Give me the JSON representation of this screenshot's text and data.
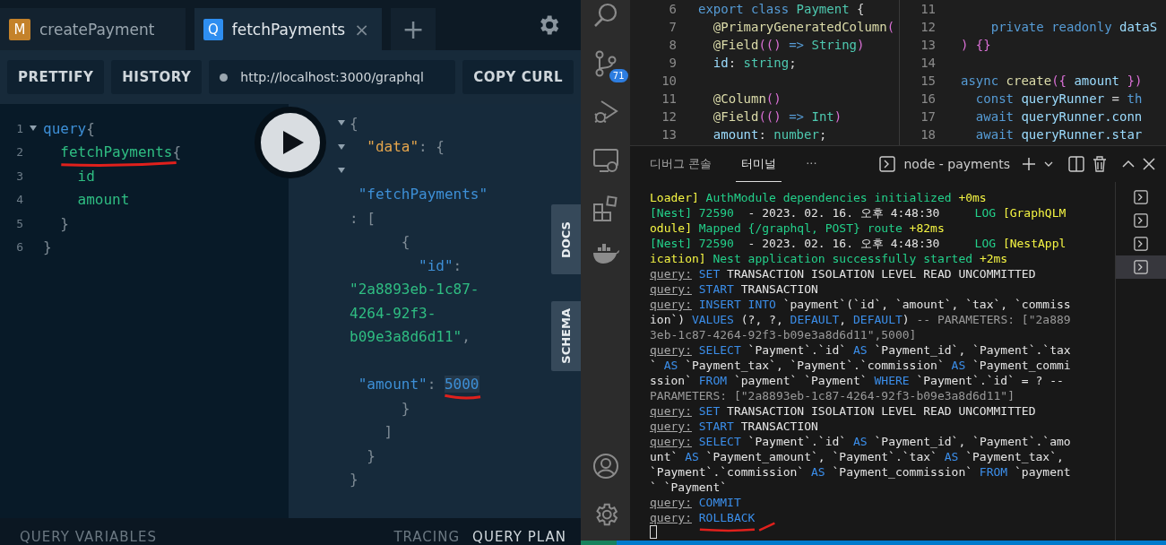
{
  "playground": {
    "tabs": [
      {
        "badge": "M",
        "kind": "mutation",
        "label": "createPayment",
        "selected": false
      },
      {
        "badge": "Q",
        "kind": "query",
        "label": "fetchPayments",
        "selected": true,
        "close": "×"
      }
    ],
    "new_tab": "+",
    "toolbar": {
      "buttons": [
        "PRETTIFY",
        "HISTORY"
      ],
      "url": "http://localhost:3000/graphql",
      "copy_button": "COPY CURL"
    },
    "query_lines": [
      {
        "number": "1",
        "fold": true,
        "tokens": [
          {
            "kind": "keyword",
            "text": "query"
          },
          {
            "kind": "punct",
            "text": "{"
          }
        ]
      },
      {
        "number": "2",
        "fold": false,
        "tokens": [
          {
            "kind": "field",
            "text": "  fetchPayments",
            "annotated": true
          },
          {
            "kind": "punct",
            "text": "{"
          }
        ]
      },
      {
        "number": "3",
        "fold": false,
        "tokens": [
          {
            "kind": "field",
            "text": "    id"
          }
        ]
      },
      {
        "number": "4",
        "fold": false,
        "tokens": [
          {
            "kind": "field",
            "text": "    amount"
          }
        ]
      },
      {
        "number": "5",
        "fold": false,
        "tokens": [
          {
            "kind": "punct",
            "text": "  }"
          }
        ]
      },
      {
        "number": "6",
        "fold": false,
        "tokens": [
          {
            "kind": "punct",
            "text": "}"
          }
        ]
      }
    ],
    "response_lines": [
      {
        "fold": true,
        "tokens": [
          {
            "kind": "punct",
            "text": "{"
          }
        ]
      },
      {
        "fold": true,
        "tokens": [
          {
            "kind": "key",
            "text": "  \"data\""
          },
          {
            "kind": "punct",
            "text": ": {"
          }
        ]
      },
      {
        "fold": true
      },
      {
        "fold": false,
        "tokens": [
          {
            "kind": "name",
            "text": " \"fetchPayments\""
          }
        ]
      },
      {
        "fold": false,
        "tokens": [
          {
            "kind": "punct",
            "text": ": ["
          }
        ]
      },
      {
        "fold": false,
        "tokens": [
          {
            "kind": "punct",
            "text": "      {"
          }
        ]
      },
      {
        "fold": false,
        "tokens": [
          {
            "kind": "name",
            "text": "        \"id\""
          },
          {
            "kind": "punct",
            "text": ":"
          }
        ]
      },
      {
        "fold": false,
        "tokens": [
          {
            "kind": "string",
            "text": "\"2a8893eb-1c87-"
          }
        ]
      },
      {
        "fold": false,
        "tokens": [
          {
            "kind": "string",
            "text": "4264-92f3-"
          }
        ]
      },
      {
        "fold": false,
        "tokens": [
          {
            "kind": "string",
            "text": "b09e3a8d6d11\""
          },
          {
            "kind": "punct",
            "text": ","
          }
        ]
      },
      {
        "fold": false
      },
      {
        "fold": false,
        "tokens": [
          {
            "kind": "name",
            "text": " \"amount\""
          },
          {
            "kind": "punct",
            "text": ": "
          },
          {
            "kind": "number",
            "text": "5000",
            "annotated": true
          }
        ]
      },
      {
        "fold": false,
        "tokens": [
          {
            "kind": "punct",
            "text": "      }"
          }
        ]
      },
      {
        "fold": false,
        "tokens": [
          {
            "kind": "punct",
            "text": "    ]"
          }
        ]
      },
      {
        "fold": false,
        "tokens": [
          {
            "kind": "punct",
            "text": "  }"
          }
        ]
      },
      {
        "fold": false,
        "tokens": [
          {
            "kind": "punct",
            "text": "}"
          }
        ]
      }
    ],
    "side_tabs": [
      "DOCS",
      "SCHEMA"
    ],
    "footer": {
      "left": "QUERY VARIABLES",
      "right": [
        {
          "label": "TRACING",
          "selected": false
        },
        {
          "label": "QUERY PLAN",
          "selected": true
        }
      ]
    }
  },
  "vscode": {
    "source_control_badge": "71",
    "editor_panes": [
      {
        "lines": [
          {
            "number": "6",
            "tokens": [
              {
                "kind": "keyword",
                "text": "export class "
              },
              {
                "kind": "type",
                "text": "Payment"
              },
              {
                "kind": "punct",
                "text": " {"
              }
            ]
          },
          {
            "number": "7",
            "tokens": [
              {
                "kind": "decorator",
                "text": "  @PrimaryGeneratedColumn"
              },
              {
                "kind": "bracket",
                "text": "("
              }
            ]
          },
          {
            "number": "8",
            "tokens": [
              {
                "kind": "decorator",
                "text": "  @Field"
              },
              {
                "kind": "bracket",
                "text": "(()"
              },
              {
                "kind": "keyword",
                "text": " => "
              },
              {
                "kind": "type",
                "text": "String"
              },
              {
                "kind": "bracket",
                "text": ")"
              }
            ]
          },
          {
            "number": "9",
            "tokens": [
              {
                "kind": "variable",
                "text": "  id"
              },
              {
                "kind": "punct",
                "text": ": "
              },
              {
                "kind": "type",
                "text": "string"
              },
              {
                "kind": "punct",
                "text": ";"
              }
            ]
          },
          {
            "number": "10"
          },
          {
            "number": "11",
            "tokens": [
              {
                "kind": "decorator",
                "text": "  @Column"
              },
              {
                "kind": "bracket",
                "text": "()"
              }
            ]
          },
          {
            "number": "12",
            "tokens": [
              {
                "kind": "decorator",
                "text": "  @Field"
              },
              {
                "kind": "bracket",
                "text": "(()"
              },
              {
                "kind": "keyword",
                "text": " => "
              },
              {
                "kind": "type",
                "text": "Int"
              },
              {
                "kind": "bracket",
                "text": ")"
              }
            ]
          },
          {
            "number": "13",
            "tokens": [
              {
                "kind": "variable",
                "text": "  amount"
              },
              {
                "kind": "punct",
                "text": ": "
              },
              {
                "kind": "type",
                "text": "number"
              },
              {
                "kind": "punct",
                "text": ";"
              }
            ]
          }
        ]
      },
      {
        "lines": [
          {
            "number": "11"
          },
          {
            "number": "12",
            "tokens": [
              {
                "kind": "keyword",
                "text": "    private readonly "
              },
              {
                "kind": "variable",
                "text": "dataS"
              }
            ]
          },
          {
            "number": "13",
            "tokens": [
              {
                "kind": "bracket",
                "text": ") {}"
              }
            ]
          },
          {
            "number": "14"
          },
          {
            "number": "15",
            "tokens": [
              {
                "kind": "keyword",
                "text": "async "
              },
              {
                "kind": "decorator",
                "text": "create"
              },
              {
                "kind": "bracket",
                "text": "({"
              },
              {
                "kind": "variable",
                "text": " amount "
              },
              {
                "kind": "bracket",
                "text": "})"
              }
            ]
          },
          {
            "number": "16",
            "tokens": [
              {
                "kind": "keyword",
                "text": "  const "
              },
              {
                "kind": "variable",
                "text": "queryRunner"
              },
              {
                "kind": "punct",
                "text": " = "
              },
              {
                "kind": "keyword",
                "text": "th"
              }
            ]
          },
          {
            "number": "17",
            "tokens": [
              {
                "kind": "keyword",
                "text": "  await "
              },
              {
                "kind": "variable",
                "text": "queryRunner.conn"
              }
            ]
          },
          {
            "number": "18",
            "tokens": [
              {
                "kind": "keyword",
                "text": "  await "
              },
              {
                "kind": "variable",
                "text": "queryRunner.star"
              }
            ]
          }
        ]
      }
    ],
    "panel": {
      "tabs": [
        {
          "label": "디버그 콘솔",
          "selected": false
        },
        {
          "label": "터미널",
          "selected": true
        }
      ],
      "more": "···",
      "terminal_name": "node - payments"
    },
    "terminal_lines": [
      [
        {
          "kind": "module",
          "text": "Loader]"
        },
        {
          "kind": "message",
          "text": " AuthModule dependencies initialized "
        },
        {
          "kind": "module",
          "text": "+0ms"
        }
      ],
      [
        {
          "kind": "message",
          "text": "[Nest] 72590"
        },
        {
          "kind": "plain",
          "text": "  - 2023. 02. 16. 오후 4:48:30     "
        },
        {
          "kind": "message",
          "text": "LOG "
        },
        {
          "kind": "module",
          "text": "[GraphQLM"
        }
      ],
      [
        {
          "kind": "module",
          "text": "odule]"
        },
        {
          "kind": "message",
          "text": " Mapped {/graphql, POST} route "
        },
        {
          "kind": "module",
          "text": "+82ms"
        }
      ],
      [
        {
          "kind": "message",
          "text": "[Nest] 72590"
        },
        {
          "kind": "plain",
          "text": "  - 2023. 02. 16. 오후 4:48:30     "
        },
        {
          "kind": "message",
          "text": "LOG "
        },
        {
          "kind": "module",
          "text": "[NestAppl"
        }
      ],
      [
        {
          "kind": "module",
          "text": "ication]"
        },
        {
          "kind": "message",
          "text": " Nest application successfully started "
        },
        {
          "kind": "module",
          "text": "+2ms"
        }
      ],
      [
        {
          "kind": "label",
          "text": "query:"
        },
        {
          "kind": "keyword",
          "text": " SET"
        },
        {
          "kind": "plain",
          "text": " TRANSACTION ISOLATION LEVEL READ UNCOMMITTED"
        }
      ],
      [
        {
          "kind": "label",
          "text": "query:"
        },
        {
          "kind": "keyword",
          "text": " START"
        },
        {
          "kind": "plain",
          "text": " TRANSACTION"
        }
      ],
      [
        {
          "kind": "label",
          "text": "query:"
        },
        {
          "kind": "keyword",
          "text": " INSERT INTO"
        },
        {
          "kind": "plain",
          "text": " `payment`(`id`, `amount`, `tax`, `commiss"
        }
      ],
      [
        {
          "kind": "plain",
          "text": "ion`) "
        },
        {
          "kind": "keyword",
          "text": "VALUES"
        },
        {
          "kind": "plain",
          "text": " (?, ?, "
        },
        {
          "kind": "keyword",
          "text": "DEFAULT"
        },
        {
          "kind": "plain",
          "text": ", "
        },
        {
          "kind": "keyword",
          "text": "DEFAULT"
        },
        {
          "kind": "plain",
          "text": ") "
        },
        {
          "kind": "comment",
          "text": "-- PARAMETERS: [\"2a889"
        }
      ],
      [
        {
          "kind": "comment",
          "text": "3eb-1c87-4264-92f3-b09e3a8d6d11\",5000]"
        }
      ],
      [
        {
          "kind": "label",
          "text": "query:"
        },
        {
          "kind": "keyword",
          "text": " SELECT"
        },
        {
          "kind": "plain",
          "text": " `Payment`.`id` "
        },
        {
          "kind": "keyword",
          "text": "AS"
        },
        {
          "kind": "plain",
          "text": " `Payment_id`, `Payment`.`tax"
        }
      ],
      [
        {
          "kind": "plain",
          "text": "` "
        },
        {
          "kind": "keyword",
          "text": "AS"
        },
        {
          "kind": "plain",
          "text": " `Payment_tax`, `Payment`.`commission` "
        },
        {
          "kind": "keyword",
          "text": "AS"
        },
        {
          "kind": "plain",
          "text": " `Payment_commi"
        }
      ],
      [
        {
          "kind": "plain",
          "text": "ssion` "
        },
        {
          "kind": "keyword",
          "text": "FROM"
        },
        {
          "kind": "plain",
          "text": " `payment` `Payment` "
        },
        {
          "kind": "keyword",
          "text": "WHERE"
        },
        {
          "kind": "plain",
          "text": " `Payment`.`id` = ? --"
        }
      ],
      [
        {
          "kind": "comment",
          "text": "PARAMETERS: [\"2a8893eb-1c87-4264-92f3-b09e3a8d6d11\"]"
        }
      ],
      [
        {
          "kind": "label",
          "text": "query:"
        },
        {
          "kind": "keyword",
          "text": " SET"
        },
        {
          "kind": "plain",
          "text": " TRANSACTION ISOLATION LEVEL READ UNCOMMITTED"
        }
      ],
      [
        {
          "kind": "label",
          "text": "query:"
        },
        {
          "kind": "keyword",
          "text": " START"
        },
        {
          "kind": "plain",
          "text": " TRANSACTION"
        }
      ],
      [
        {
          "kind": "label",
          "text": "query:"
        },
        {
          "kind": "keyword",
          "text": " SELECT"
        },
        {
          "kind": "plain",
          "text": " `Payment`.`id` "
        },
        {
          "kind": "keyword",
          "text": "AS"
        },
        {
          "kind": "plain",
          "text": " `Payment_id`, `Payment`.`amo"
        }
      ],
      [
        {
          "kind": "plain",
          "text": "unt` "
        },
        {
          "kind": "keyword",
          "text": "AS"
        },
        {
          "kind": "plain",
          "text": " `Payment_amount`, `Payment`.`tax` "
        },
        {
          "kind": "keyword",
          "text": "AS"
        },
        {
          "kind": "plain",
          "text": " `Payment_tax`,"
        }
      ],
      [
        {
          "kind": "plain",
          "text": "`Payment`.`commission` "
        },
        {
          "kind": "keyword",
          "text": "AS"
        },
        {
          "kind": "plain",
          "text": " `Payment_commission` "
        },
        {
          "kind": "keyword",
          "text": "FROM"
        },
        {
          "kind": "plain",
          "text": " `payment"
        }
      ],
      [
        {
          "kind": "plain",
          "text": "` `Payment`"
        }
      ],
      [
        {
          "kind": "label",
          "text": "query:"
        },
        {
          "kind": "keyword",
          "text": " COMMIT"
        }
      ],
      [
        {
          "kind": "label",
          "text": "query:"
        },
        {
          "kind": "keyword",
          "text": " ROLLBACK",
          "annotated": true
        }
      ]
    ],
    "terminals": [
      {
        "selected": false
      },
      {
        "selected": false
      },
      {
        "selected": false
      },
      {
        "selected": true
      }
    ]
  }
}
